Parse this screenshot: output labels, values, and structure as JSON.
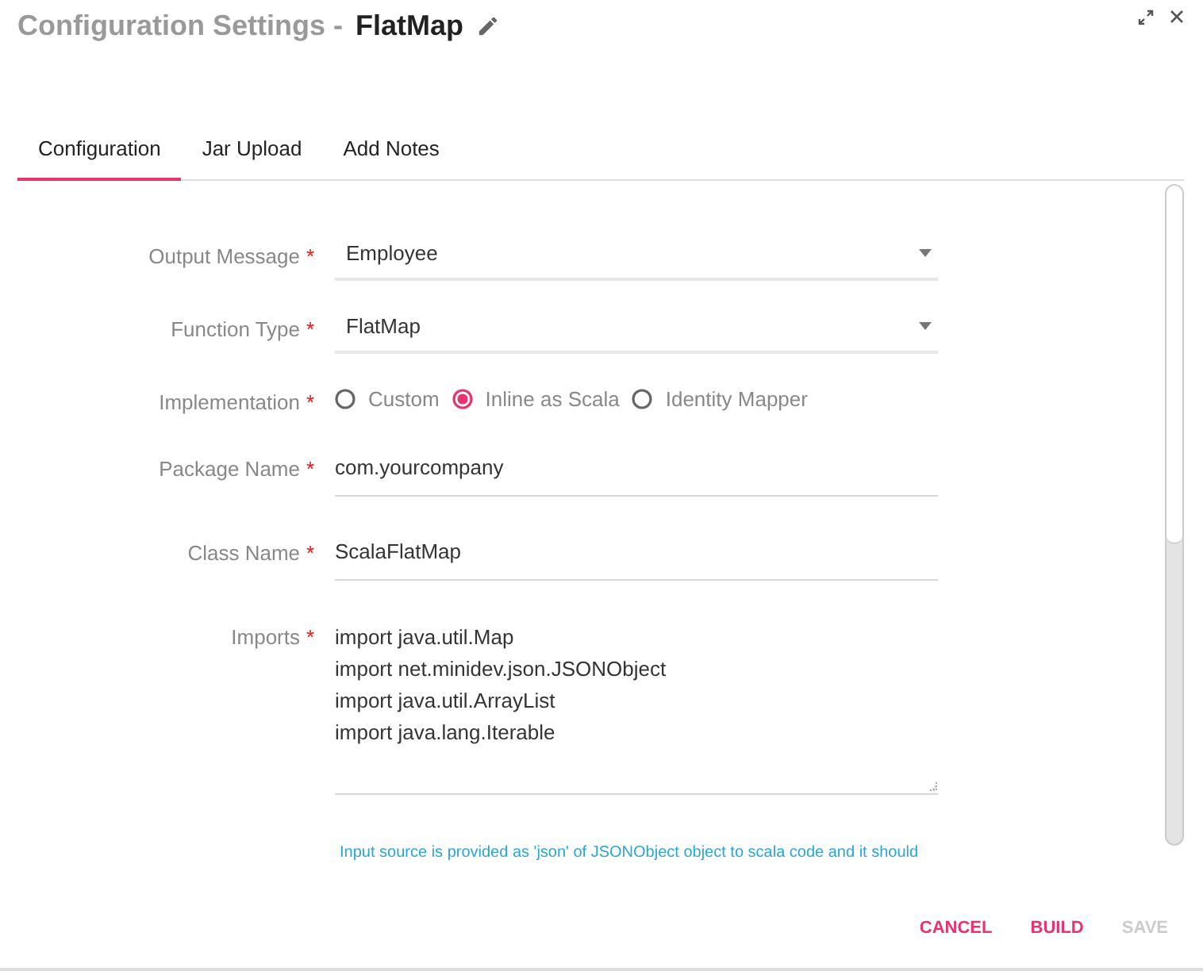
{
  "window": {
    "title": "Configuration Settings -",
    "name": "FlatMap"
  },
  "tabs": [
    {
      "label": "Configuration",
      "selected": true
    },
    {
      "label": "Jar Upload",
      "selected": false
    },
    {
      "label": "Add Notes",
      "selected": false
    }
  ],
  "form": {
    "fields": [
      {
        "kind": "select",
        "label": "Output Message",
        "required_mark": "*",
        "value": "Employee"
      },
      {
        "kind": "select",
        "label": "Function Type",
        "required_mark": "*",
        "value": "FlatMap"
      },
      {
        "kind": "radio",
        "label": "Implementation",
        "required_mark": "*",
        "options": [
          {
            "label": "Custom",
            "selected": false
          },
          {
            "label": "Inline as Scala",
            "selected": true
          },
          {
            "label": "Identity Mapper",
            "selected": false
          }
        ]
      },
      {
        "kind": "text",
        "label": "Package Name",
        "required_mark": "*",
        "value": "com.yourcompany"
      },
      {
        "kind": "text",
        "label": "Class Name",
        "required_mark": "*",
        "value": "ScalaFlatMap"
      },
      {
        "kind": "textarea",
        "label": "Imports",
        "required_mark": "*",
        "lines": [
          "import java.util.Map",
          "import net.minidev.json.JSONObject",
          "import java.util.ArrayList",
          "import java.lang.Iterable"
        ]
      }
    ],
    "help_text": "Input source is provided as 'json' of JSONObject object to scala code and it should"
  },
  "buttons": [
    {
      "label": "CANCEL",
      "disabled": false
    },
    {
      "label": "BUILD",
      "disabled": false
    },
    {
      "label": "SAVE",
      "disabled": true
    }
  ]
}
